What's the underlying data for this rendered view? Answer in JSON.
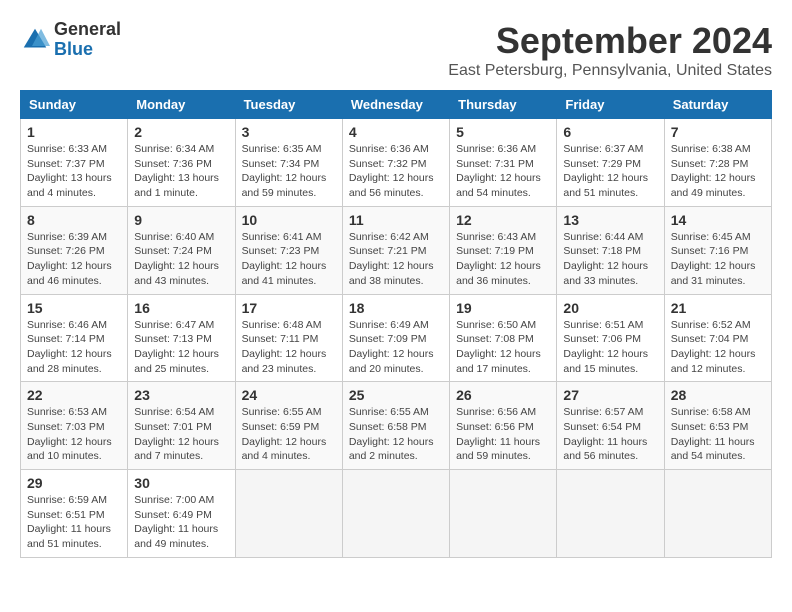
{
  "header": {
    "logo_line1": "General",
    "logo_line2": "Blue",
    "main_title": "September 2024",
    "subtitle": "East Petersburg, Pennsylvania, United States"
  },
  "calendar": {
    "days_of_week": [
      "Sunday",
      "Monday",
      "Tuesday",
      "Wednesday",
      "Thursday",
      "Friday",
      "Saturday"
    ],
    "weeks": [
      [
        {
          "day": "1",
          "info": "Sunrise: 6:33 AM\nSunset: 7:37 PM\nDaylight: 13 hours\nand 4 minutes."
        },
        {
          "day": "2",
          "info": "Sunrise: 6:34 AM\nSunset: 7:36 PM\nDaylight: 13 hours\nand 1 minute."
        },
        {
          "day": "3",
          "info": "Sunrise: 6:35 AM\nSunset: 7:34 PM\nDaylight: 12 hours\nand 59 minutes."
        },
        {
          "day": "4",
          "info": "Sunrise: 6:36 AM\nSunset: 7:32 PM\nDaylight: 12 hours\nand 56 minutes."
        },
        {
          "day": "5",
          "info": "Sunrise: 6:36 AM\nSunset: 7:31 PM\nDaylight: 12 hours\nand 54 minutes."
        },
        {
          "day": "6",
          "info": "Sunrise: 6:37 AM\nSunset: 7:29 PM\nDaylight: 12 hours\nand 51 minutes."
        },
        {
          "day": "7",
          "info": "Sunrise: 6:38 AM\nSunset: 7:28 PM\nDaylight: 12 hours\nand 49 minutes."
        }
      ],
      [
        {
          "day": "8",
          "info": "Sunrise: 6:39 AM\nSunset: 7:26 PM\nDaylight: 12 hours\nand 46 minutes."
        },
        {
          "day": "9",
          "info": "Sunrise: 6:40 AM\nSunset: 7:24 PM\nDaylight: 12 hours\nand 43 minutes."
        },
        {
          "day": "10",
          "info": "Sunrise: 6:41 AM\nSunset: 7:23 PM\nDaylight: 12 hours\nand 41 minutes."
        },
        {
          "day": "11",
          "info": "Sunrise: 6:42 AM\nSunset: 7:21 PM\nDaylight: 12 hours\nand 38 minutes."
        },
        {
          "day": "12",
          "info": "Sunrise: 6:43 AM\nSunset: 7:19 PM\nDaylight: 12 hours\nand 36 minutes."
        },
        {
          "day": "13",
          "info": "Sunrise: 6:44 AM\nSunset: 7:18 PM\nDaylight: 12 hours\nand 33 minutes."
        },
        {
          "day": "14",
          "info": "Sunrise: 6:45 AM\nSunset: 7:16 PM\nDaylight: 12 hours\nand 31 minutes."
        }
      ],
      [
        {
          "day": "15",
          "info": "Sunrise: 6:46 AM\nSunset: 7:14 PM\nDaylight: 12 hours\nand 28 minutes."
        },
        {
          "day": "16",
          "info": "Sunrise: 6:47 AM\nSunset: 7:13 PM\nDaylight: 12 hours\nand 25 minutes."
        },
        {
          "day": "17",
          "info": "Sunrise: 6:48 AM\nSunset: 7:11 PM\nDaylight: 12 hours\nand 23 minutes."
        },
        {
          "day": "18",
          "info": "Sunrise: 6:49 AM\nSunset: 7:09 PM\nDaylight: 12 hours\nand 20 minutes."
        },
        {
          "day": "19",
          "info": "Sunrise: 6:50 AM\nSunset: 7:08 PM\nDaylight: 12 hours\nand 17 minutes."
        },
        {
          "day": "20",
          "info": "Sunrise: 6:51 AM\nSunset: 7:06 PM\nDaylight: 12 hours\nand 15 minutes."
        },
        {
          "day": "21",
          "info": "Sunrise: 6:52 AM\nSunset: 7:04 PM\nDaylight: 12 hours\nand 12 minutes."
        }
      ],
      [
        {
          "day": "22",
          "info": "Sunrise: 6:53 AM\nSunset: 7:03 PM\nDaylight: 12 hours\nand 10 minutes."
        },
        {
          "day": "23",
          "info": "Sunrise: 6:54 AM\nSunset: 7:01 PM\nDaylight: 12 hours\nand 7 minutes."
        },
        {
          "day": "24",
          "info": "Sunrise: 6:55 AM\nSunset: 6:59 PM\nDaylight: 12 hours\nand 4 minutes."
        },
        {
          "day": "25",
          "info": "Sunrise: 6:55 AM\nSunset: 6:58 PM\nDaylight: 12 hours\nand 2 minutes."
        },
        {
          "day": "26",
          "info": "Sunrise: 6:56 AM\nSunset: 6:56 PM\nDaylight: 11 hours\nand 59 minutes."
        },
        {
          "day": "27",
          "info": "Sunrise: 6:57 AM\nSunset: 6:54 PM\nDaylight: 11 hours\nand 56 minutes."
        },
        {
          "day": "28",
          "info": "Sunrise: 6:58 AM\nSunset: 6:53 PM\nDaylight: 11 hours\nand 54 minutes."
        }
      ],
      [
        {
          "day": "29",
          "info": "Sunrise: 6:59 AM\nSunset: 6:51 PM\nDaylight: 11 hours\nand 51 minutes."
        },
        {
          "day": "30",
          "info": "Sunrise: 7:00 AM\nSunset: 6:49 PM\nDaylight: 11 hours\nand 49 minutes."
        },
        {
          "day": "",
          "info": ""
        },
        {
          "day": "",
          "info": ""
        },
        {
          "day": "",
          "info": ""
        },
        {
          "day": "",
          "info": ""
        },
        {
          "day": "",
          "info": ""
        }
      ]
    ]
  }
}
